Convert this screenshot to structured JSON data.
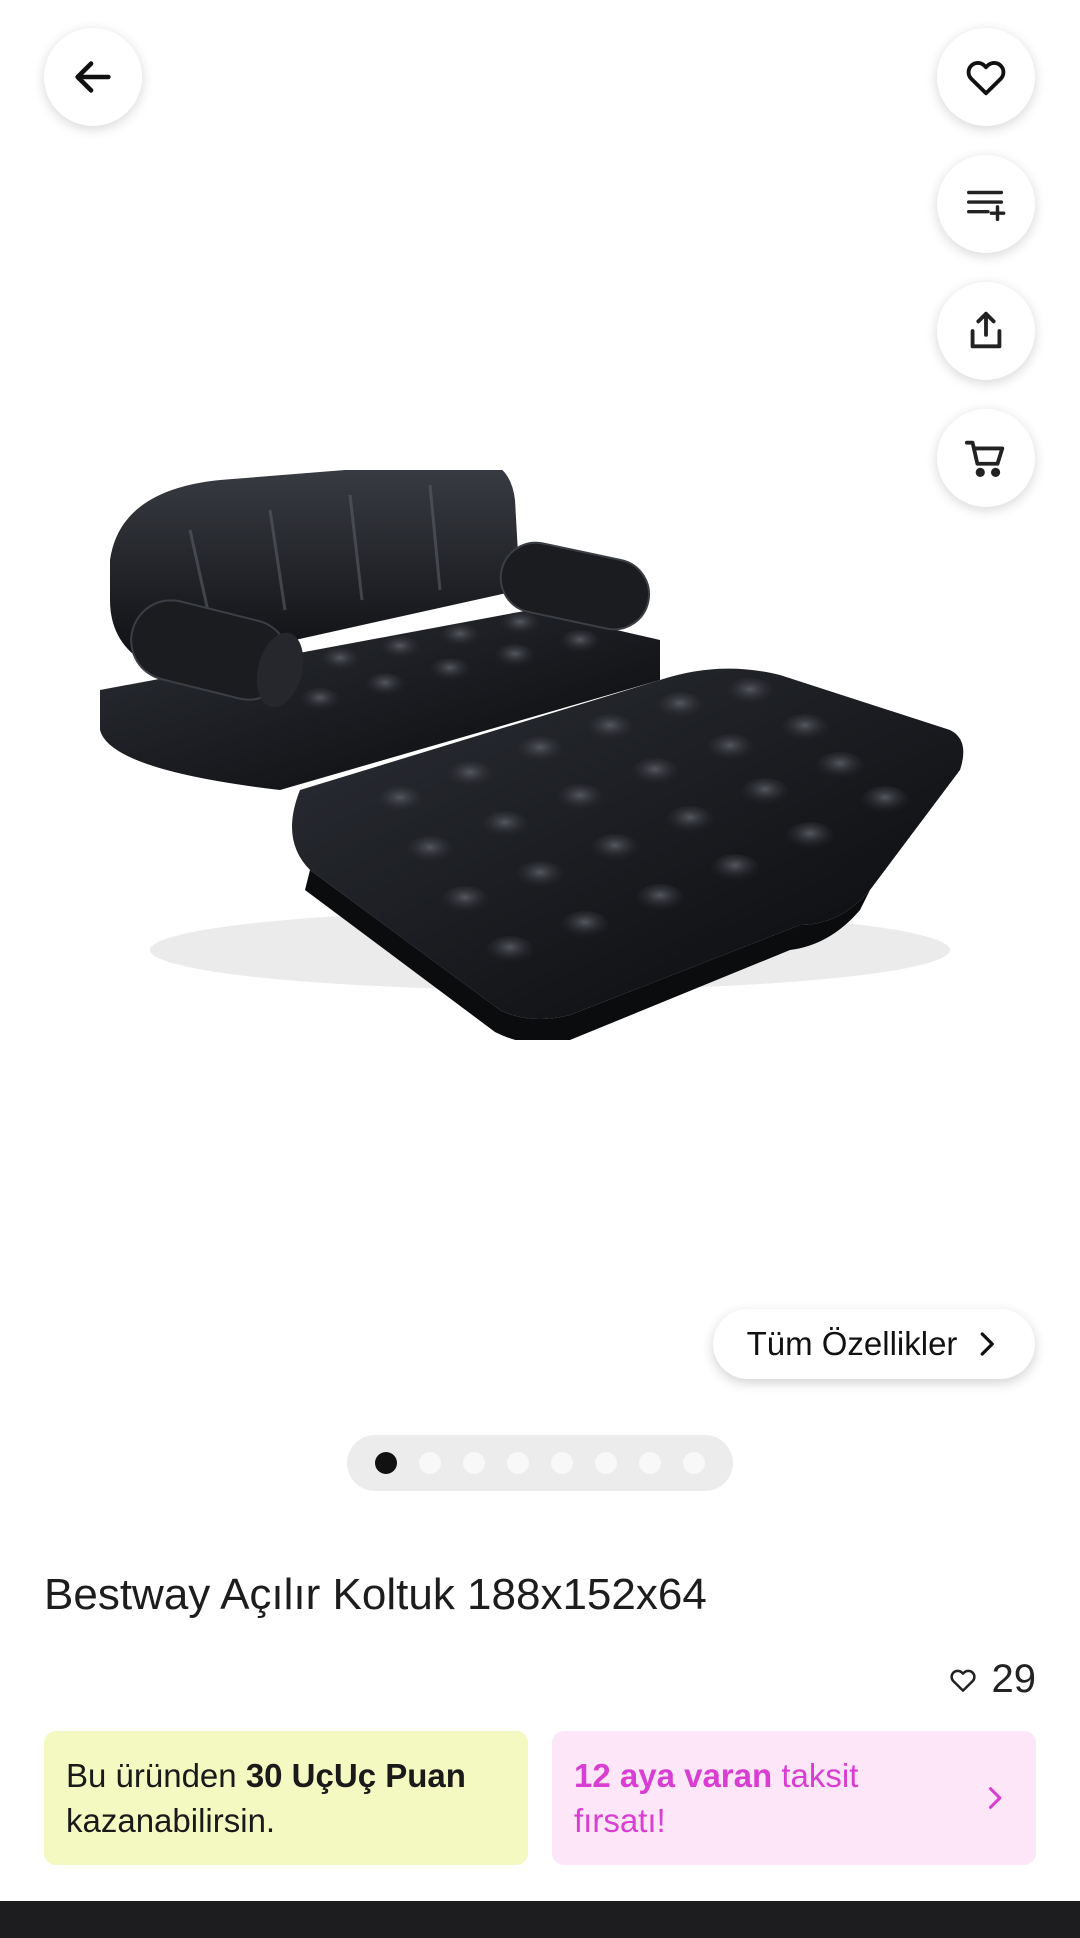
{
  "header": {
    "back_icon": "arrow-left-icon",
    "favorite_icon": "heart-icon",
    "list_icon": "add-to-list-icon",
    "share_icon": "share-icon",
    "cart_icon": "cart-icon"
  },
  "gallery": {
    "image_alt": "Black inflatable sofa bed",
    "specs_label": "Tüm Özellikler",
    "total_images": 8,
    "active_index": 0
  },
  "product": {
    "title": "Bestway Açılır Koltuk 188x152x64",
    "likes": "29"
  },
  "promos": {
    "points_prefix": "Bu üründen ",
    "points_bold": "30 UçUç Puan",
    "points_suffix": "kazanabilirsin.",
    "taksit_bold": "12 aya varan",
    "taksit_text": " taksit fırsatı!"
  },
  "colors": {
    "points_bg": "#f3f9c0",
    "taksit_bg": "#fde6f8",
    "taksit_fg": "#d83ed1"
  }
}
